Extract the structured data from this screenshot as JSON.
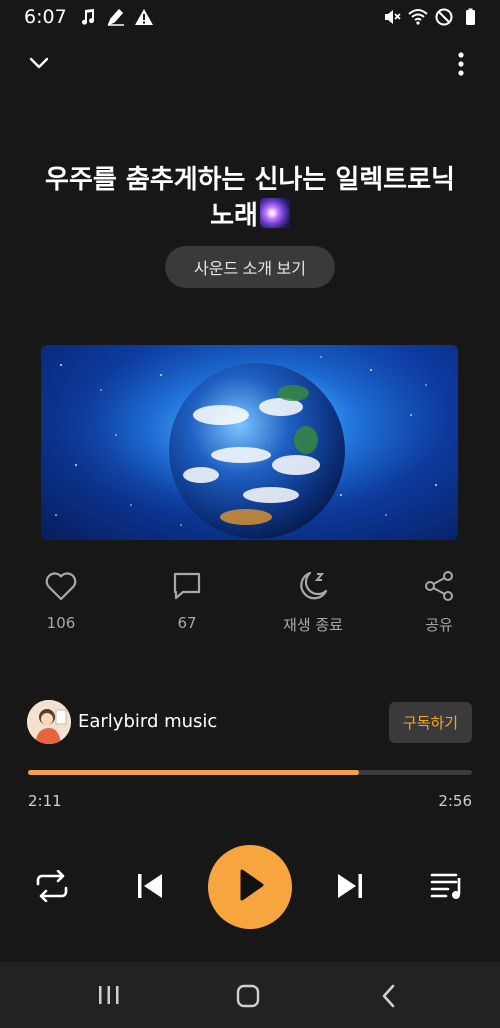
{
  "status_bar": {
    "time": "6:07",
    "left_icons": [
      "music-note-icon",
      "pen-icon",
      "warning-icon"
    ],
    "right_icons": [
      "mute-icon",
      "wifi-icon",
      "do-not-disturb-icon",
      "battery-icon"
    ]
  },
  "top_bar": {
    "collapse_icon": "chevron-down-icon",
    "menu_icon": "more-vert-icon"
  },
  "song": {
    "title": "우주를 춤추게하는 신나는 일렉트로닉 노래",
    "title_emoji": "galaxy-emoji",
    "sound_intro_label": "사운드 소개 보기"
  },
  "actions": {
    "like_count": "106",
    "comment_count": "67",
    "sleep_timer_label": "재생 종료",
    "share_label": "공유"
  },
  "channel": {
    "name": "Earlybird music",
    "subscribe_label": "구독하기"
  },
  "player": {
    "current_time": "2:11",
    "total_time": "2:56",
    "progress_fraction": 0.746
  },
  "colors": {
    "accent": "#f7a53e",
    "background": "#171717",
    "button_bg": "#3a3a3a"
  }
}
